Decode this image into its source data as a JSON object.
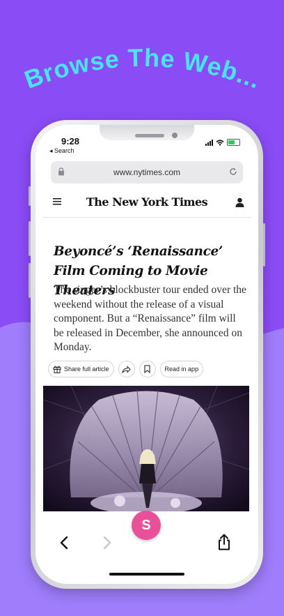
{
  "promo": {
    "headline": "Browse The Web..."
  },
  "status_bar": {
    "time": "9:28",
    "back_label": "◂ Search"
  },
  "browser": {
    "url": "www.nytimes.com"
  },
  "nyt": {
    "masthead": "The New York Times"
  },
  "article": {
    "title": "Beyoncé’s ‘Renaissance’ Film Coming to Movie Theaters",
    "summary": "The singer’s blockbuster tour ended over the weekend without the release of a visual component. But a “Renaissance” film will be released in December, she announced on Monday.",
    "share_label": "Share full article",
    "read_in_app_label": "Read in app"
  },
  "app_button": {
    "label": "S"
  },
  "colors": {
    "background": "#8a4cf5",
    "headline": "#4ae3f0",
    "app_button": "#e8519a"
  }
}
